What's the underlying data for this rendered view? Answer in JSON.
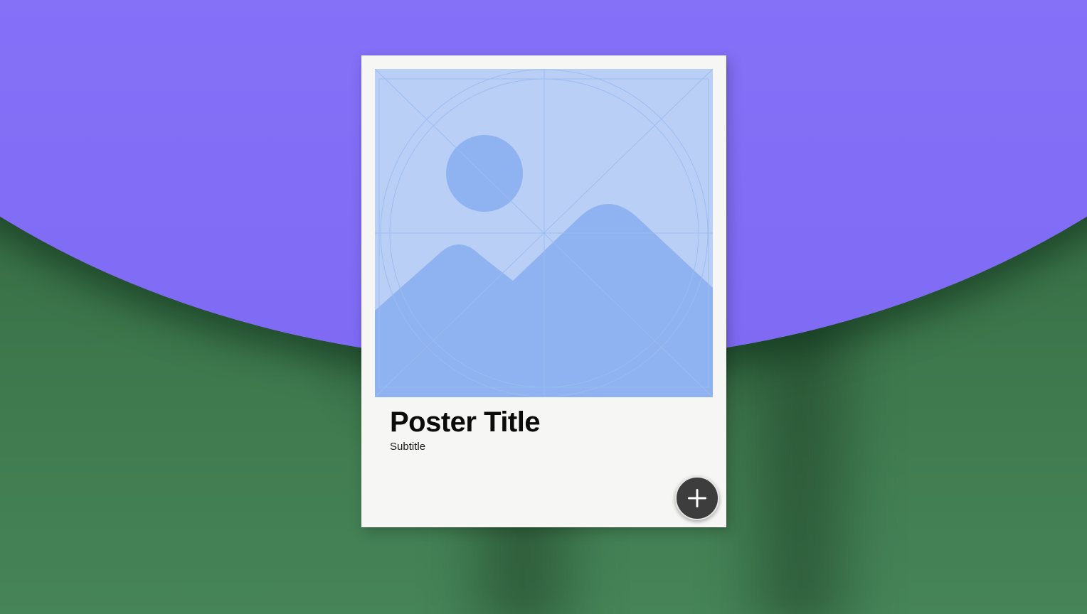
{
  "poster": {
    "title": "Poster Title",
    "subtitle": "Subtitle",
    "image_icon": "image-placeholder-icon"
  },
  "add_button": {
    "icon": "plus-icon",
    "color": "#3d3d3d"
  },
  "colors": {
    "purple_backdrop": "#8a77fa",
    "green_backdrop": "#3f7a4f",
    "image_placeholder": "#b9cff5",
    "image_shapes": "#8fb3f0"
  }
}
